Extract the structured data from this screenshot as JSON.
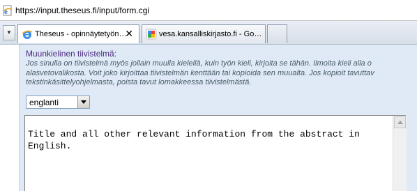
{
  "browser": {
    "address": {
      "url": "https://input.theseus.fi/input/form.cgi",
      "icon": "ie-page-icon"
    },
    "tabs": [
      {
        "label": "Theseus - opinnäytetyön…",
        "icon": "ie-e-icon",
        "active": true,
        "close": "✕"
      },
      {
        "label": "vesa.kansalliskirjasto.fi - Go…",
        "icon": "google-icon",
        "active": false
      }
    ],
    "tab_menu_icon": "▼"
  },
  "form": {
    "section_title": "Muunkielinen tiivistelmä:",
    "help_lines": [
      "Jos sinulla on tiivistelmä myös jollain muulla kielellä, kuin työn kieli, kirjoita se tähän. Ilmoita kieli alla o",
      "alasvetovalikosta. Voit joko kirjoittaa tiivistelmän kenttään tai kopioida sen muualta. Jos kopioit tavuttav",
      "tekstinkäsittelyohjelmasta, poista tavut lomakkeessa tiivistelmästä."
    ],
    "language_select": {
      "selected": "englanti"
    },
    "abstract_text": "Title and all other relevant information from the abstract in English."
  },
  "colors": {
    "panel_bg": "#dfeaf6",
    "title_color": "#4b2a7d",
    "help_color": "#4a5a6a"
  }
}
